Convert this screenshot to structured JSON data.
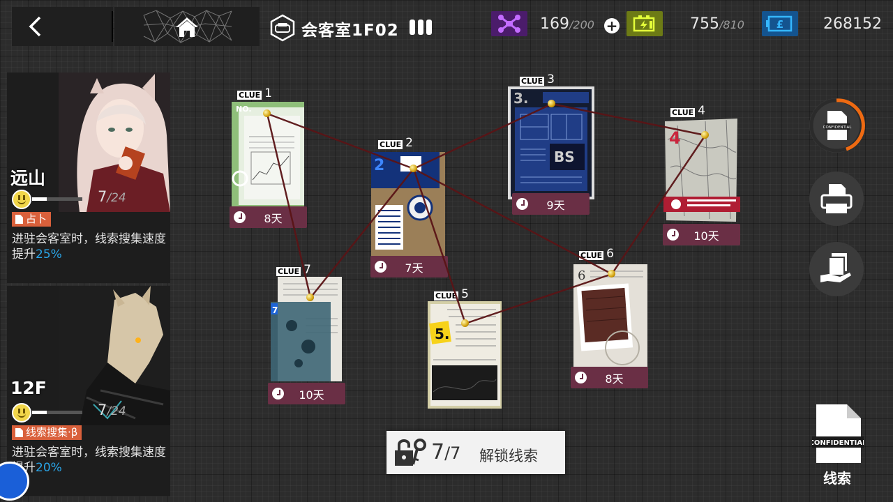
{
  "header": {
    "back": "back-icon",
    "home": "home-icon",
    "room_title": "会客室1F02",
    "drone": {
      "value": "169",
      "max": "/200"
    },
    "energy": {
      "value": "755",
      "max": "/810"
    },
    "money": "268152",
    "colors": {
      "drone": "#4b1c6b",
      "energy": "#6d7b15",
      "money": "#14548f"
    }
  },
  "operators": [
    {
      "name": "远山",
      "mood_value": "7",
      "mood_max": "/24",
      "mood_fraction": 0.29,
      "skill": "占卜",
      "desc_prefix": "进驻会客室时，线索搜集速度提升",
      "desc_pct": "25%"
    },
    {
      "name": "12F",
      "mood_value": "7",
      "mood_max": "/24",
      "mood_fraction": 0.29,
      "skill": "线索搜集·β",
      "desc_prefix": "进驻会客室时，线索搜集速度提升",
      "desc_pct": "20%"
    }
  ],
  "clues": [
    {
      "label": "CLUE",
      "num": "1",
      "time": "8天"
    },
    {
      "label": "CLUE",
      "num": "2",
      "time": "7天"
    },
    {
      "label": "CLUE",
      "num": "3",
      "time": "9天"
    },
    {
      "label": "CLUE",
      "num": "4",
      "time": "10天"
    },
    {
      "label": "CLUE",
      "num": "5",
      "time": ""
    },
    {
      "label": "CLUE",
      "num": "6",
      "time": "8天"
    },
    {
      "label": "CLUE",
      "num": "7",
      "time": "10天"
    }
  ],
  "unlock": {
    "count": "7",
    "max": "/7",
    "label": "解锁线索"
  },
  "side": {
    "confidential_label": "CONFIDENTIAL",
    "clues_label": "线索"
  }
}
